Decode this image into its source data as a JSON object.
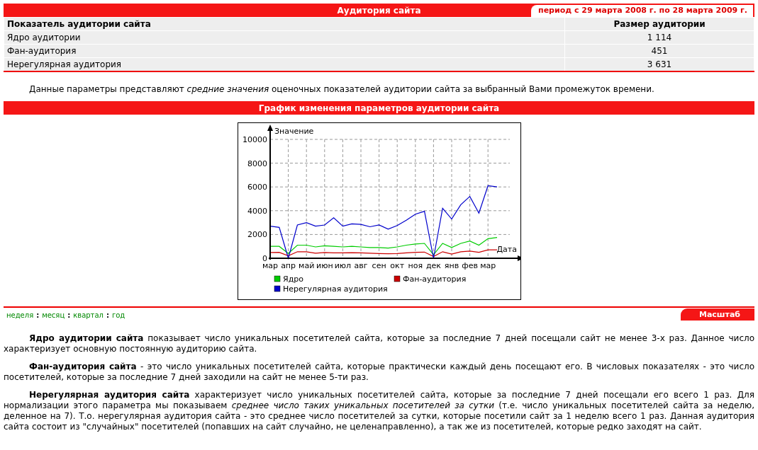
{
  "header": {
    "title": "Аудитория сайта",
    "period": "период с 29 марта 2008 г. по 28 марта 2009 г."
  },
  "table": {
    "columns": [
      "Показатель аудитории сайта",
      "Размер аудитории"
    ],
    "rows": [
      {
        "indicator": "Ядро аудитории",
        "size": "1 114"
      },
      {
        "indicator": "Фан-аудитория",
        "size": "451"
      },
      {
        "indicator": "Нерегулярная аудитория",
        "size": "3 631"
      }
    ]
  },
  "note": "Данные параметры представляют *средние значения* оценочных показателей аудитории сайта за выбранный Вами промежуток времени.",
  "chart_section": {
    "title": "График изменения параметров аудитории сайта",
    "chart_data": {
      "type": "line",
      "xlabel": "Дата",
      "ylabel": "Значение",
      "categories": [
        "мар",
        null,
        "апр",
        null,
        "май",
        null,
        "июн",
        null,
        "июл",
        null,
        "авг",
        null,
        "сен",
        null,
        "окт",
        null,
        "ноя",
        null,
        "дек",
        null,
        "янв",
        null,
        "фев",
        null,
        "мар",
        null
      ],
      "ylim": [
        0,
        10000
      ],
      "grid": true,
      "legend": "bottom",
      "yticks": [
        0,
        2000,
        4000,
        6000,
        8000,
        10000
      ],
      "series": [
        {
          "name": "Ядро",
          "color": "#00cc00",
          "values": [
            1000,
            1000,
            400,
            1100,
            1100,
            950,
            1050,
            1000,
            950,
            1000,
            950,
            900,
            900,
            850,
            950,
            1100,
            1200,
            1250,
            300,
            1250,
            900,
            1250,
            1450,
            1100,
            1650,
            1750
          ]
        },
        {
          "name": "Фан-аудитория",
          "color": "#cc0000",
          "values": [
            480,
            500,
            200,
            550,
            550,
            420,
            480,
            450,
            450,
            470,
            450,
            420,
            400,
            380,
            400,
            450,
            500,
            520,
            150,
            550,
            350,
            550,
            600,
            500,
            700,
            700
          ]
        },
        {
          "name": "Нерегулярная аудитория",
          "color": "#0000cc",
          "values": [
            2700,
            2600,
            0,
            2800,
            3000,
            2700,
            2800,
            3400,
            2700,
            2900,
            2850,
            2650,
            2800,
            2450,
            2750,
            3200,
            3700,
            3950,
            0,
            4200,
            3300,
            4500,
            5200,
            3800,
            6100,
            6000
          ]
        }
      ]
    }
  },
  "scale_bar": {
    "periods": [
      "неделя",
      "месяц",
      "квартал",
      "год"
    ],
    "separator": ":",
    "button": "Масштаб"
  },
  "descriptions": [
    "**Ядро аудитории сайта** показывает число уникальных посетителей сайта, которые за последние 7 дней посещали сайт не менее 3-х раз. Данное число характеризует основную постоянную аудиторию сайта.",
    "**Фан-аудитория сайта** - это число уникальных посетителей сайта, которые практически каждый день посещают его. В числовых показателях - это число посетителей, которые за последние 7 дней заходили на сайт не менее 5-ти раз.",
    "**Нерегулярная аудитория сайта** характеризует число уникальных посетителей сайта, которые за последние 7 дней посещали его всего 1 раз. Для нормализации этого параметра мы показываем *среднее число таких уникальных посетителей за сутки* (т.е. число уникальных посетителей сайта за неделю, деленное на 7). Т.о. нерегулярная аудитория сайта - это среднее число посетителей за сутки, которые посетили сайт за 1 неделю всего 1 раз. Данная аудитория сайта состоит из \"случайных\" посетителей (попавших на сайт случайно, не целенаправленно), а так же из посетителей, которые редко заходят на сайт."
  ]
}
